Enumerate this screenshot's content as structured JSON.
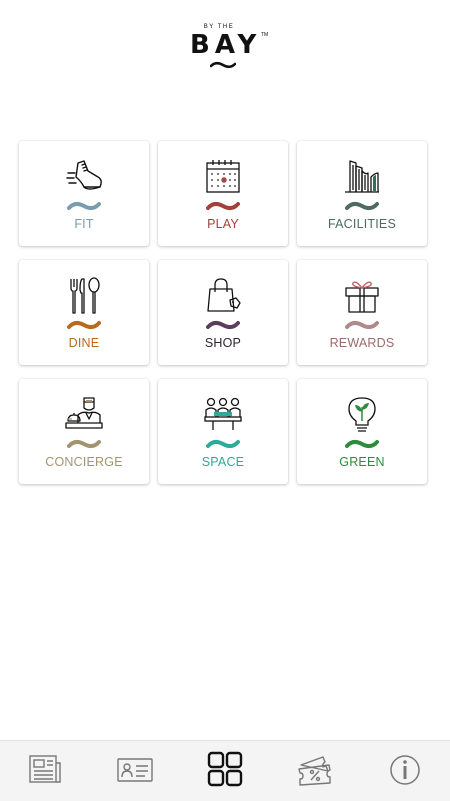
{
  "header": {
    "logo_small": "BY THE",
    "logo_big": "BAY",
    "logo_tm": "TM"
  },
  "tiles": [
    {
      "label": "FIT",
      "color": "#7b9cad",
      "icon": "running-shoe-icon"
    },
    {
      "label": "PLAY",
      "color": "#a2403c",
      "icon": "calendar-icon"
    },
    {
      "label": "FACILITIES",
      "color": "#4d6b62",
      "icon": "buildings-icon"
    },
    {
      "label": "DINE",
      "color": "#b96a1c",
      "icon": "cutlery-icon"
    },
    {
      "label": "SHOP",
      "color": "#5c3d5e",
      "icon": "shopping-bag-icon"
    },
    {
      "label": "REWARDS",
      "color": "#9a6b6b",
      "icon": "gift-icon"
    },
    {
      "label": "CONCIERGE",
      "color": "#a29470",
      "icon": "concierge-icon"
    },
    {
      "label": "SPACE",
      "color": "#2ea99a",
      "icon": "meeting-space-icon"
    },
    {
      "label": "GREEN",
      "color": "#2c8c3b",
      "icon": "eco-bulb-icon"
    }
  ],
  "bottom_nav": [
    {
      "icon": "newspaper-icon"
    },
    {
      "icon": "id-card-icon"
    },
    {
      "icon": "grid-menu-icon"
    },
    {
      "icon": "ticket-discount-icon"
    },
    {
      "icon": "info-icon"
    }
  ]
}
